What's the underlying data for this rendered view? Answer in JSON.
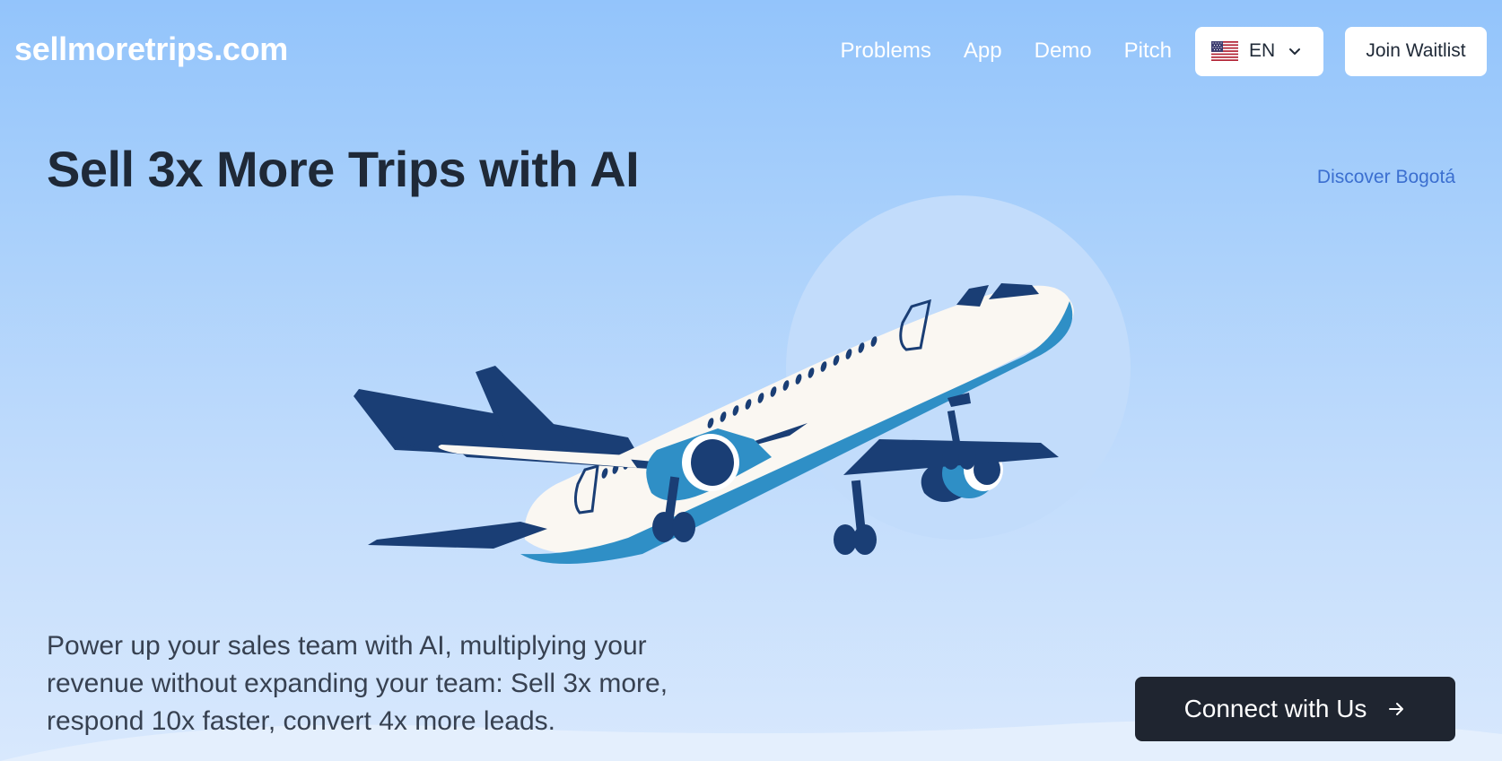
{
  "header": {
    "logo": "sellmoretrips.com",
    "nav": {
      "problems": "Problems",
      "app": "App",
      "demo": "Demo",
      "pitch": "Pitch"
    },
    "language": {
      "selected": "EN",
      "flag_icon": "us-flag-icon"
    },
    "waitlist_label": "Join Waitlist"
  },
  "hero": {
    "headline": "Sell 3x More Trips with AI",
    "discover_link": "Discover Bogotá",
    "illustration": "airplane-illustration",
    "lead": "Power up your sales team with AI, multiplying your revenue without expanding your team: Sell 3x more, respond 10x faster, convert 4x more leads.",
    "cta_label": "Connect with Us",
    "cta_icon": "arrow-right-icon"
  },
  "colors": {
    "background_top": "#93c4fb",
    "background_bottom": "#d8e8fd",
    "navy": "#1a3e75",
    "plane_blue": "#2f8fc6",
    "cta_bg": "#1f2530",
    "link": "#3b6fd0"
  }
}
